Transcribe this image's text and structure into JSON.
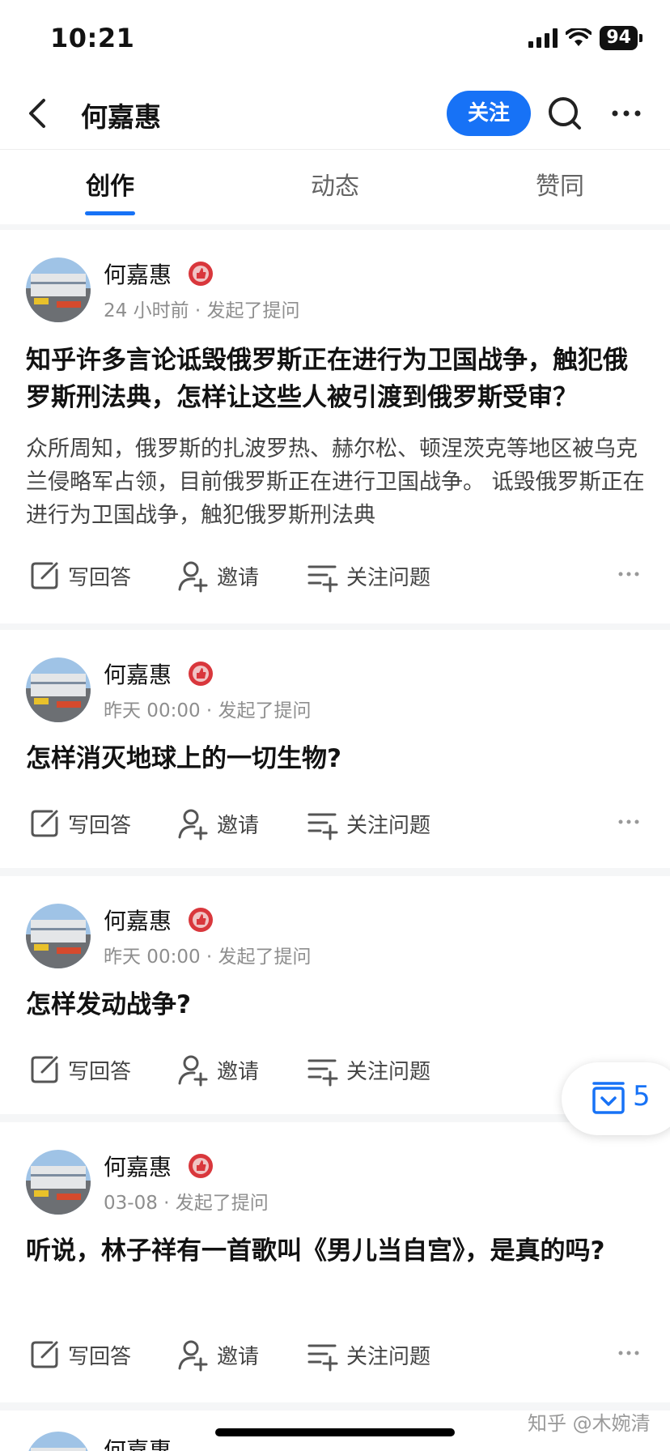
{
  "status": {
    "time": "10:21",
    "battery": "94"
  },
  "header": {
    "title": "何嘉惠",
    "follow_label": "关注"
  },
  "tabs": [
    {
      "label": "创作",
      "active": true
    },
    {
      "label": "动态",
      "active": false
    },
    {
      "label": "赞同",
      "active": false
    }
  ],
  "actions": {
    "answer": "写回答",
    "invite": "邀请",
    "follow_question": "关注问题"
  },
  "posts": [
    {
      "author": "何嘉惠",
      "time": "24 小时前",
      "action": "发起了提问",
      "title": "知乎许多言论诋毁俄罗斯正在进行为卫国战争，触犯俄罗斯刑法典，怎样让这些人被引渡到俄罗斯受审？",
      "excerpt": "众所周知，俄罗斯的扎波罗热、赫尔松、顿涅茨克等地区被乌克兰侵略军占领，目前俄罗斯正在进行卫国战争。 诋毁俄罗斯正在进行为卫国战争，触犯俄罗斯刑法典"
    },
    {
      "author": "何嘉惠",
      "time": "昨天 00:00",
      "action": "发起了提问",
      "title": "怎样消灭地球上的一切生物?"
    },
    {
      "author": "何嘉惠",
      "time": "昨天 00:00",
      "action": "发起了提问",
      "title": "怎样发动战争?"
    },
    {
      "author": "何嘉惠",
      "time": "03-08",
      "action": "发起了提问",
      "title": "听说，林子祥有一首歌叫《男儿当自宫》，是真的吗?"
    },
    {
      "author": "何嘉惠"
    }
  ],
  "meta_separator": "·",
  "floating": {
    "count": "5"
  },
  "watermark": "知乎 @木婉清",
  "colors": {
    "accent": "#1772f6",
    "badge": "#d9373c"
  }
}
